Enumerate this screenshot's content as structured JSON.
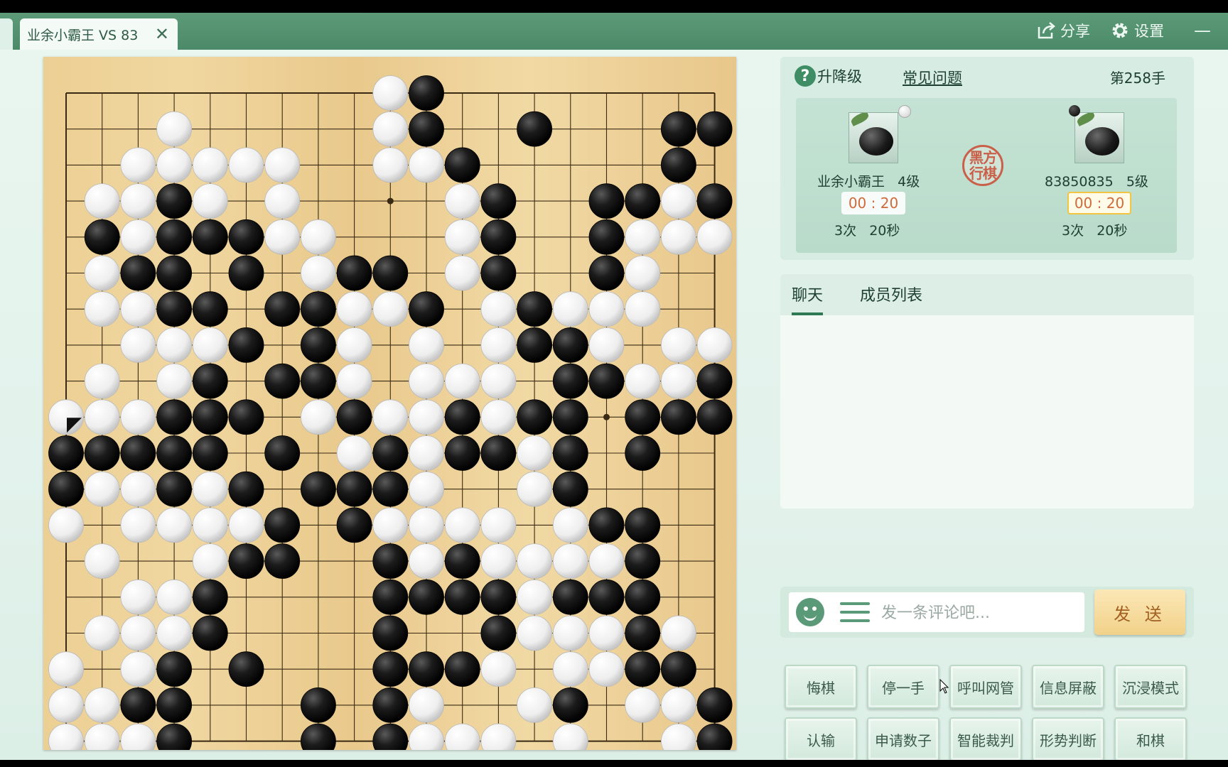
{
  "tab": {
    "title": "业余小霸王 VS 83",
    "close": "✕"
  },
  "titlebar": {
    "share": "分享",
    "settings": "设置",
    "minimize": "—"
  },
  "info": {
    "help": "升降级",
    "faq": "常见问题",
    "move_count": "第258手"
  },
  "players": {
    "white": {
      "name": "业余小霸王",
      "rank": "4级",
      "timer": "00 : 20",
      "periods": "3次",
      "seconds": "20秒",
      "stone": "white"
    },
    "black": {
      "name": "83850835",
      "rank": "5级",
      "timer": "00 : 20",
      "periods": "3次",
      "seconds": "20秒",
      "stone": "black"
    },
    "turn_seal": "黑方行棋"
  },
  "chat": {
    "tab_chat": "聊天",
    "tab_members": "成员列表",
    "placeholder": "发一条评论吧...",
    "send": "发 送"
  },
  "actions": {
    "row1": [
      "悔棋",
      "停一手",
      "呼叫网管",
      "信息屏蔽",
      "沉浸模式"
    ],
    "row2": [
      "认输",
      "申请数子",
      "智能裁判",
      "形势判断",
      "和棋"
    ]
  },
  "board": {
    "size": 19,
    "rows": [
      ".........WB........",
      "...W.....WB..B...BB",
      "..WWWWW..WWB.....B.",
      ".WWBW.W....WB..BBWBB",
      ".BWBBBWW...WB..BWWWW",
      ".WBB.B.WBB.WB..BW..",
      ".WWBB.BBWWB.WBWWW..",
      "..WWWB.BW.W.WBBW.WW",
      ".W.WB.BBW.WWW.BBWWB",
      "WWWBBB.WBWWBWBB.BBB",
      "BBBBB.B.WBWBBWB.B..",
      "BWWBWB.BBBW..WB....",
      "W.WWWWB.BWWWW.WBB..",
      ".W..WBB..BWBWWWWB..",
      "..WWB....BBBBWBBB..",
      ".WWWB....B..BWWWBW.",
      "W.WB.B...BBBW.WWBB.",
      "WWBB...B.BW..WB.WWB.",
      "WWWB...B.BWWW.W..WBB"
    ],
    "last_move": "A9"
  }
}
